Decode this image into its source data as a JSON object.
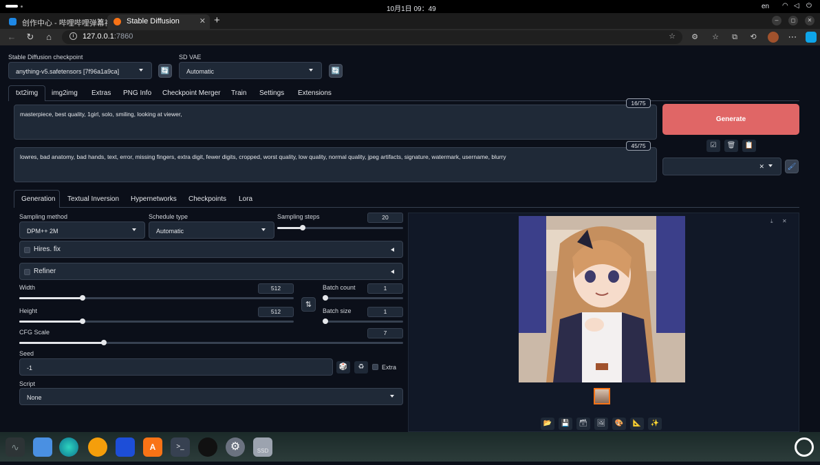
{
  "os": {
    "clock": "10月1日  09：49",
    "lang": "en"
  },
  "browser": {
    "tabs": [
      {
        "label": "创作中心 - 哔哩哔哩弹幕视",
        "close": "✕"
      },
      {
        "label": "Stable Diffusion",
        "close": "✕"
      }
    ],
    "new_tab": "+",
    "url_host": "127.0.0.1",
    "url_port": ":7860"
  },
  "sd": {
    "checkpoint_label": "Stable Diffusion checkpoint",
    "checkpoint_value": "anything-v5.safetensors [7f96a1a9ca]",
    "vae_label": "SD VAE",
    "vae_value": "Automatic",
    "main_tabs": [
      "txt2img",
      "img2img",
      "Extras",
      "PNG Info",
      "Checkpoint Merger",
      "Train",
      "Settings",
      "Extensions"
    ],
    "prompt": "masterpiece, best quality, 1girl, solo, smiling, looking at viewer,",
    "prompt_count": "16/75",
    "negative_prompt": "lowres, bad anatomy, bad hands, text, error, missing fingers, extra digit, fewer digits, cropped, worst quality, low quality, normal quality, jpeg artifacts, signature, watermark, username, blurry",
    "negative_count": "45/75",
    "generate": "Generate",
    "sub_tabs": [
      "Generation",
      "Textual Inversion",
      "Hypernetworks",
      "Checkpoints",
      "Lora"
    ],
    "sampling_method_label": "Sampling method",
    "sampling_method": "DPM++ 2M",
    "schedule_type_label": "Schedule type",
    "schedule_type": "Automatic",
    "sampling_steps_label": "Sampling steps",
    "sampling_steps": "20",
    "hires_fix": "Hires. fix",
    "refiner": "Refiner",
    "width_label": "Width",
    "width": "512",
    "height_label": "Height",
    "height": "512",
    "batch_count_label": "Batch count",
    "batch_count": "1",
    "batch_size_label": "Batch size",
    "batch_size": "1",
    "cfg_label": "CFG Scale",
    "cfg": "7",
    "seed_label": "Seed",
    "seed": "-1",
    "extra_label": "Extra",
    "script_label": "Script",
    "script_value": "None"
  },
  "sliders": {
    "sampling_steps_fraction": 0.2,
    "width_fraction": 0.23,
    "height_fraction": 0.23,
    "cfg_fraction": 0.22,
    "batch_count_fraction": 0.0,
    "batch_size_fraction": 0.0
  },
  "colors": {
    "generate_bg": "#e06666",
    "accent": "#e5e7eb"
  }
}
